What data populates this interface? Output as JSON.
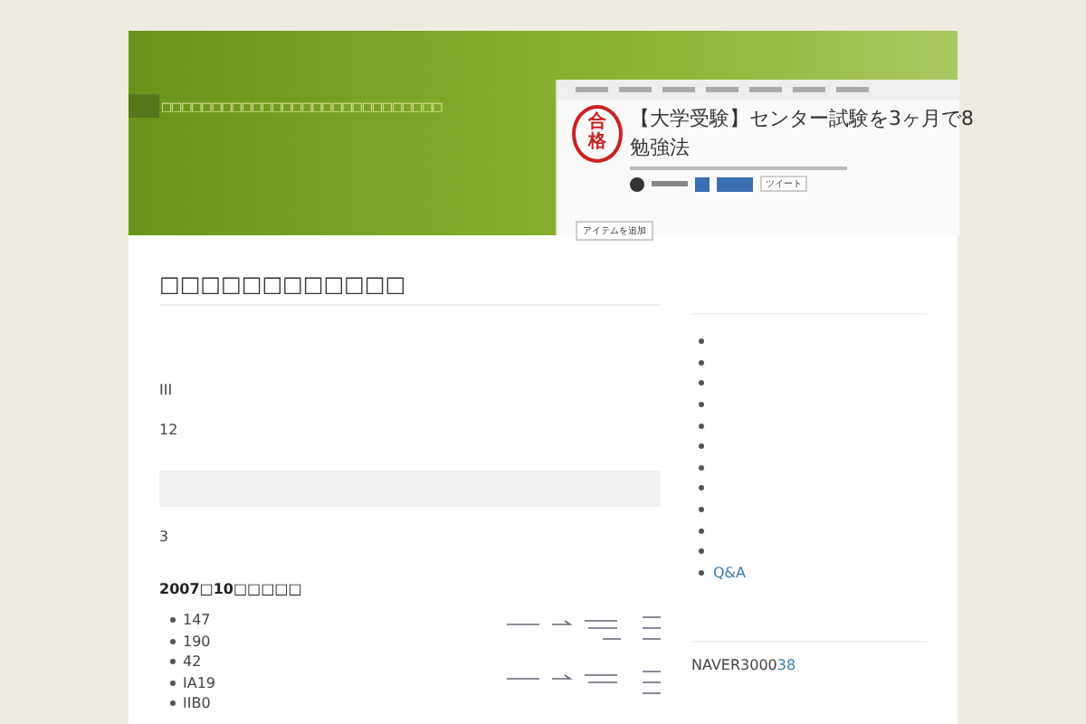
{
  "header": {
    "tagline": "□□□□□□□□□□□□□□□□□□□□□□□□□□□□",
    "screenshot": {
      "stamp": "合格",
      "title": "【大学受験】センター試験を3ヶ月で8",
      "title_line2": "勉強法",
      "tweet": "ツイート",
      "add_item": "アイテムを追加"
    }
  },
  "article": {
    "heading": "□□□□□□□□□□□□",
    "blocks": [
      {
        "kind": "text",
        "text": "III"
      },
      {
        "kind": "text",
        "text": "12"
      },
      {
        "kind": "box"
      },
      {
        "kind": "text",
        "text": "3"
      },
      {
        "kind": "subheading",
        "text": "2007□10□□□□□"
      }
    ],
    "list": [
      "147",
      "190",
      "42",
      "IA19",
      "IIB0"
    ]
  },
  "sidebar": {
    "items": [
      {
        "kind": "empty"
      },
      {
        "kind": "empty"
      },
      {
        "kind": "empty"
      },
      {
        "kind": "empty"
      },
      {
        "kind": "empty"
      },
      {
        "kind": "empty"
      },
      {
        "kind": "empty"
      },
      {
        "kind": "empty"
      },
      {
        "kind": "empty"
      },
      {
        "kind": "empty"
      },
      {
        "kind": "empty"
      },
      {
        "kind": "link",
        "label": "Q&A"
      }
    ],
    "stats": {
      "text": "NAVER3000",
      "link": "38"
    }
  }
}
